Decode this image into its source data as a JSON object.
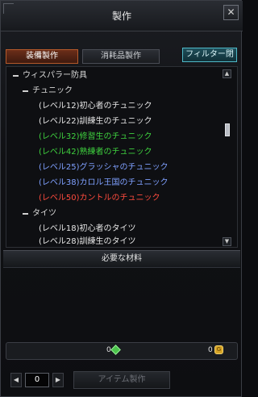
{
  "window": {
    "title": "製作",
    "close_glyph": "✕"
  },
  "tabs": [
    {
      "label": "装備製作",
      "active": true
    },
    {
      "label": "消耗品製作",
      "active": false
    }
  ],
  "filter_button": "フィルター閉",
  "tree": {
    "category": "ウィスパラー防具",
    "groups": [
      {
        "label": "チュニック",
        "items": [
          {
            "label": "(レベル12)初心者のチュニック",
            "color": "#e6e6e6"
          },
          {
            "label": "(レベル22)訓練生のチュニック",
            "color": "#e6e6e6"
          },
          {
            "label": "(レベル32)修習生のチュニック",
            "color": "#3fd23f"
          },
          {
            "label": "(レベル42)熟練者のチュニック",
            "color": "#3fd23f"
          },
          {
            "label": "(レベル25)グラッシャのチュニック",
            "color": "#7fa0ff"
          },
          {
            "label": "(レベル38)カロル王国のチュニック",
            "color": "#7fa0ff"
          },
          {
            "label": "(レベル50)カントルのチュニック",
            "color": "#ff4b3e"
          }
        ]
      },
      {
        "label": "タイツ",
        "items": [
          {
            "label": "(レベル18)初心者のタイツ",
            "color": "#e6e6e6"
          },
          {
            "label": "(レベル28)訓練生のタイツ",
            "color": "#e6e6e6"
          }
        ]
      }
    ]
  },
  "materials_header": "必要な材料",
  "cost": {
    "gem_amount": "0",
    "gold_amount": "0"
  },
  "quantity": "0",
  "craft_button": "アイテム製作",
  "colors": {
    "accent_tab": "#b55a2b",
    "filter": "#4fb9c8"
  }
}
